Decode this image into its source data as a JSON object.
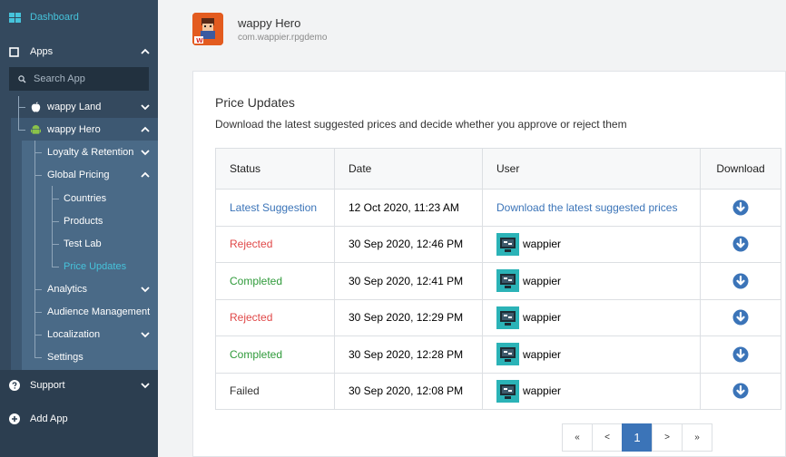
{
  "sidebar": {
    "dashboard": "Dashboard",
    "apps": "Apps",
    "search_placeholder": "Search App",
    "wappy_land": "wappy Land",
    "wappy_hero": "wappy Hero",
    "loyalty": "Loyalty & Retention",
    "global_pricing": "Global Pricing",
    "countries": "Countries",
    "products": "Products",
    "test_lab": "Test Lab",
    "price_updates": "Price Updates",
    "analytics": "Analytics",
    "audience": "Audience Management",
    "localization": "Localization",
    "settings": "Settings",
    "support": "Support",
    "add_app": "Add App"
  },
  "header": {
    "app_name": "wappy Hero",
    "app_package": "com.wappier.rpgdemo"
  },
  "main": {
    "title": "Price Updates",
    "description": "Download the latest suggested prices and decide whether you approve or reject them",
    "columns": [
      "Status",
      "Date",
      "User",
      "Download"
    ],
    "rows": [
      {
        "status": "Latest Suggestion",
        "status_type": "latest",
        "date": "12 Oct 2020, 11:23 AM",
        "user": "Download the latest suggested prices",
        "user_is_link": true
      },
      {
        "status": "Rejected",
        "status_type": "rejected",
        "date": "30 Sep 2020, 12:46 PM",
        "user": "wappier",
        "user_is_link": false
      },
      {
        "status": "Completed",
        "status_type": "completed",
        "date": "30 Sep 2020, 12:41 PM",
        "user": "wappier",
        "user_is_link": false
      },
      {
        "status": "Rejected",
        "status_type": "rejected",
        "date": "30 Sep 2020, 12:29 PM",
        "user": "wappier",
        "user_is_link": false
      },
      {
        "status": "Completed",
        "status_type": "completed",
        "date": "30 Sep 2020, 12:28 PM",
        "user": "wappier",
        "user_is_link": false
      },
      {
        "status": "Failed",
        "status_type": "failed",
        "date": "30 Sep 2020, 12:08 PM",
        "user": "wappier",
        "user_is_link": false
      }
    ]
  },
  "pagination": {
    "first": "«",
    "prev": "<",
    "current": "1",
    "next": ">",
    "last": "»"
  },
  "colors": {
    "sidebar_bg": "#2c3e50",
    "accent": "#3b74b8",
    "dashboard_active": "#46c3db",
    "rejected": "#e04848",
    "completed": "#2f9a3a"
  }
}
